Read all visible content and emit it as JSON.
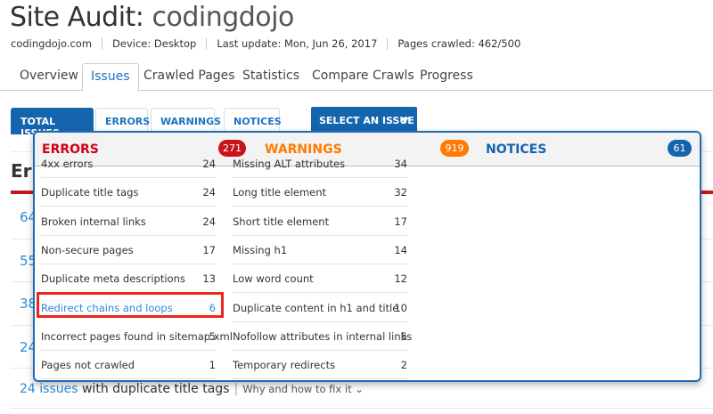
{
  "header": {
    "title_prefix": "Site Audit:",
    "title_site": "codingdojo",
    "domain": "codingdojo.com",
    "device": "Device: Desktop",
    "last_update": "Last update: Mon, Jun 26, 2017",
    "pages_crawled": "Pages crawled: 462/500"
  },
  "nav_tabs": [
    "Overview",
    "Issues",
    "Crawled Pages",
    "Statistics",
    "Compare Crawls",
    "Progress"
  ],
  "filters": [
    "TOTAL ISSUES",
    "ERRORS",
    "WARNINGS",
    "NOTICES"
  ],
  "select_label": "SELECT AN ISSUE",
  "background": {
    "heading": "Err",
    "numbers": [
      "64",
      "55",
      "38",
      "24"
    ],
    "bottom_link": "24 issues",
    "bottom_text": "with duplicate title tags",
    "why": "Why and how to fix it"
  },
  "popup": {
    "errors": {
      "label": "ERRORS",
      "count": "271",
      "color": "#d0021b",
      "items": [
        {
          "label": "4xx errors",
          "count": "24"
        },
        {
          "label": "Duplicate title tags",
          "count": "24"
        },
        {
          "label": "Broken internal links",
          "count": "24"
        },
        {
          "label": "Non-secure pages",
          "count": "17"
        },
        {
          "label": "Duplicate meta descriptions",
          "count": "13"
        },
        {
          "label": "Redirect chains and loops",
          "count": "6"
        },
        {
          "label": "Incorrect pages found in sitemap.xml",
          "count": "5"
        },
        {
          "label": "Pages not crawled",
          "count": "1"
        }
      ]
    },
    "warnings": {
      "label": "WARNINGS",
      "count": "919",
      "color": "#ff7a00",
      "items": [
        {
          "label": "Missing ALT attributes",
          "count": "34"
        },
        {
          "label": "Long title element",
          "count": "32"
        },
        {
          "label": "Short title element",
          "count": "17"
        },
        {
          "label": "Missing h1",
          "count": "14"
        },
        {
          "label": "Low word count",
          "count": "12"
        },
        {
          "label": "Duplicate content in h1 and title",
          "count": "10"
        },
        {
          "label": "Nofollow attributes in internal links",
          "count": "5"
        },
        {
          "label": "Temporary redirects",
          "count": "2"
        }
      ]
    },
    "notices": {
      "label": "NOTICES",
      "count": "61",
      "color": "#1565ae"
    }
  }
}
